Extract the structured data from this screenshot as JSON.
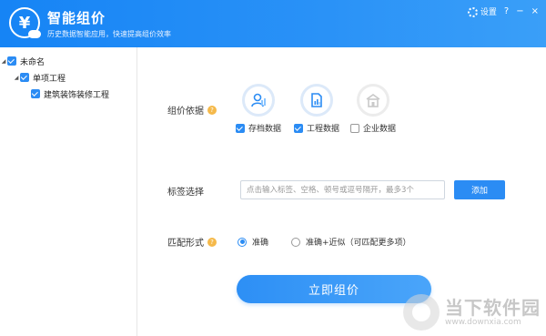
{
  "header": {
    "title": "智能组价",
    "subtitle": "历史数据智能应用，快速提高组价效率",
    "settings_label": "设置",
    "help_label": "?",
    "minimize_label": "−",
    "close_label": "×",
    "accent": "#1684f5"
  },
  "tree": {
    "items": [
      {
        "label": "未命名",
        "checked": true,
        "level": 0
      },
      {
        "label": "单项工程",
        "checked": true,
        "level": 1
      },
      {
        "label": "建筑装饰装修工程",
        "checked": true,
        "level": 2
      }
    ]
  },
  "basis": {
    "label": "组价依据",
    "help": "?",
    "options": [
      {
        "label": "存档数据",
        "checked": true,
        "icon": "person-icon"
      },
      {
        "label": "工程数据",
        "checked": true,
        "icon": "document-chart-icon"
      },
      {
        "label": "企业数据",
        "checked": false,
        "icon": "building-icon"
      }
    ]
  },
  "tags": {
    "label": "标签选择",
    "placeholder": "点击输入标签、空格、顿号或逗号隔开，最多3个",
    "value": "",
    "add_label": "添加"
  },
  "match": {
    "label": "匹配形式",
    "help": "?",
    "options": [
      {
        "label": "准确",
        "selected": true
      },
      {
        "label": "准确+近似（可匹配更多项）",
        "selected": false
      }
    ]
  },
  "submit_label": "立即组价",
  "watermark": {
    "name": "当下软件园",
    "url": "www.downxia.com"
  }
}
